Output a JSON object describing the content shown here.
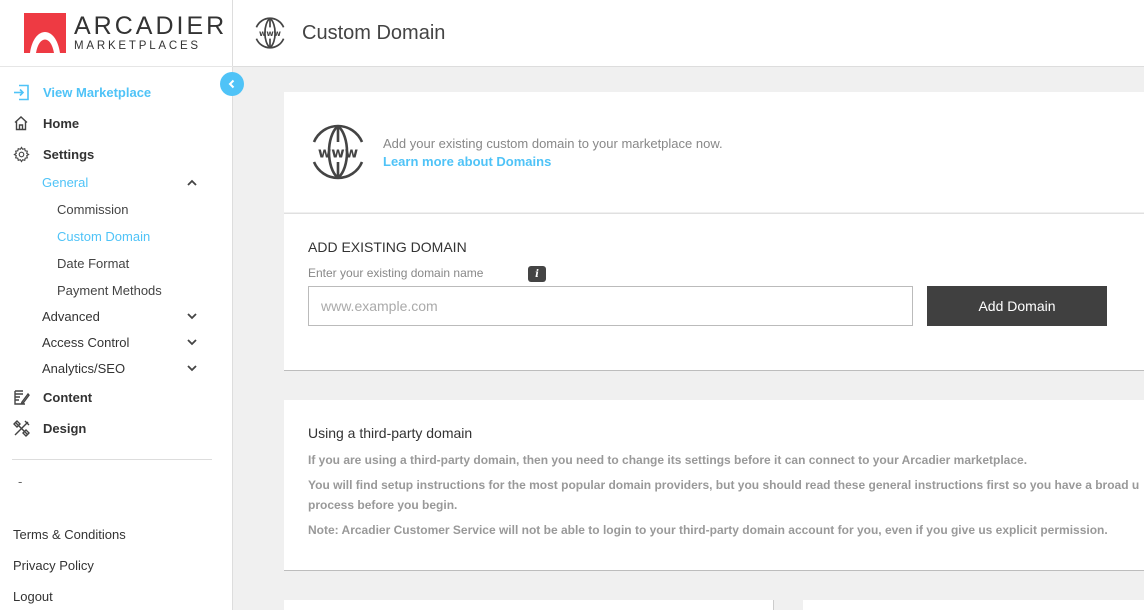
{
  "logo": {
    "title": "ARCADIER",
    "subtitle": "MARKETPLACES",
    "brand_color": "#ee3a43"
  },
  "accent_color": "#4fc3f7",
  "sidebar": {
    "collapse_icon": "chevron-left-icon",
    "nav": [
      {
        "label": "View Marketplace",
        "icon": "enter-icon",
        "active": true
      },
      {
        "label": "Home",
        "icon": "home-icon"
      },
      {
        "label": "Settings",
        "icon": "gear-icon"
      },
      {
        "label": "Content",
        "icon": "edit-icon"
      },
      {
        "label": "Design",
        "icon": "tools-icon"
      }
    ],
    "settings_sub": [
      {
        "label": "General",
        "expanded": true,
        "icon": "chevron-up-icon"
      },
      {
        "label": "Advanced",
        "icon": "chevron-down-icon"
      },
      {
        "label": "Access Control",
        "icon": "chevron-down-icon"
      },
      {
        "label": "Analytics/SEO",
        "icon": "chevron-down-icon"
      }
    ],
    "general_sub": [
      {
        "label": "Commission"
      },
      {
        "label": "Custom Domain",
        "active": true
      },
      {
        "label": "Date Format"
      },
      {
        "label": "Payment Methods"
      }
    ],
    "dash": "-",
    "footer": [
      {
        "label": "Terms & Conditions"
      },
      {
        "label": "Privacy Policy"
      },
      {
        "label": "Logout"
      }
    ]
  },
  "header": {
    "title": "Custom Domain",
    "icon": "www-globe-icon"
  },
  "intro": {
    "text": "Add your existing custom domain to your marketplace now.",
    "link": "Learn more about Domains"
  },
  "add_domain": {
    "heading": "ADD EXISTING DOMAIN",
    "label": "Enter your existing domain name",
    "info": "i",
    "placeholder": "www.example.com",
    "value": "",
    "button": "Add Domain"
  },
  "third_party": {
    "heading": "Using a third-party domain",
    "p1": "If you are using a third-party domain, then you need to change its settings before it can connect to your Arcadier marketplace.",
    "p2a": "You will find setup instructions for the most popular domain providers, but you should read these general instructions first so you have a broad u",
    "p2b": "process before you begin.",
    "p3": "Note: Arcadier Customer Service will not be able to login to your third-party domain account for you, even if you give us explicit permission."
  }
}
